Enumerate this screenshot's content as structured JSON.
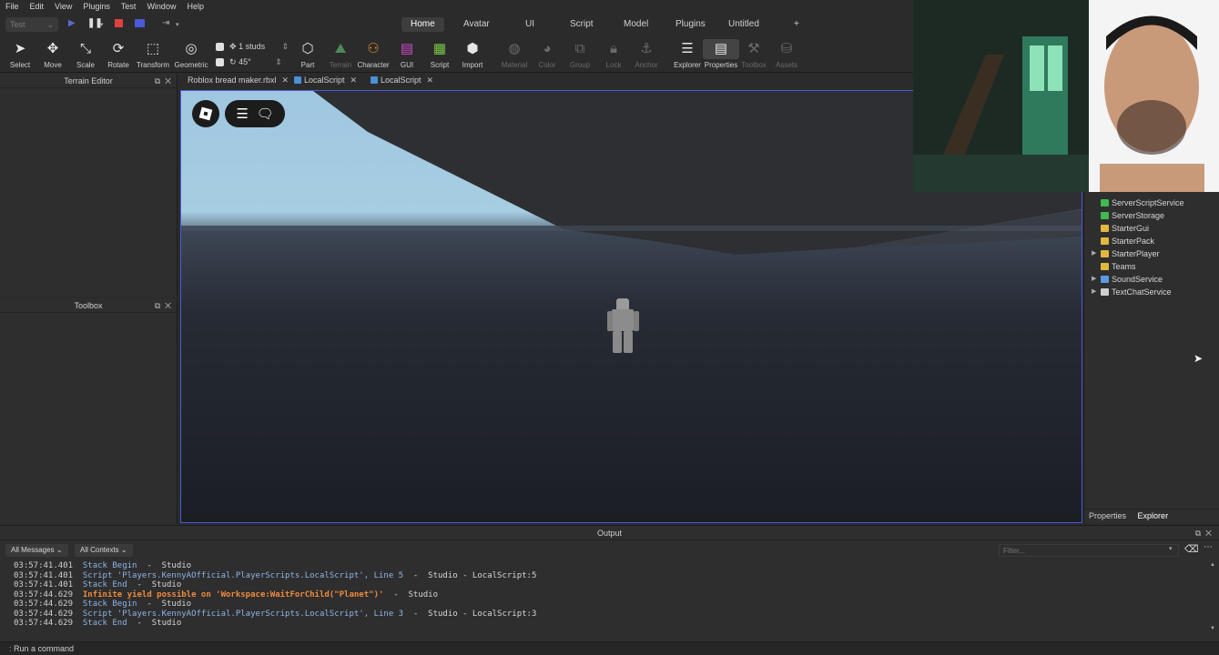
{
  "menu": [
    "File",
    "Edit",
    "View",
    "Plugins",
    "Test",
    "Window",
    "Help"
  ],
  "test_select": "Test",
  "ribbon_tabs": [
    "Home",
    "Avatar",
    "UI",
    "Script",
    "Model",
    "Plugins",
    "Untitled",
    "+"
  ],
  "ribbon_active": "Home",
  "tools": {
    "select": "Select",
    "move": "Move",
    "scale": "Scale",
    "rotate": "Rotate",
    "transform": "Transform",
    "geometric": "Geometric",
    "part": "Part",
    "terrain": "Terrain",
    "character": "Character",
    "gui": "GUI",
    "script": "Script",
    "import": "Import",
    "material": "Material",
    "color": "Color",
    "group": "Group",
    "lock": "Lock",
    "anchor": "Anchor",
    "explorer": "Explorer",
    "properties": "Properties",
    "toolbox": "Toolbox",
    "assets": "Assets"
  },
  "snap": {
    "move": "1 studs",
    "rotate": "45°"
  },
  "panels": {
    "terrain_editor": "Terrain Editor",
    "toolbox": "Toolbox",
    "output": "Output"
  },
  "doc_tabs": [
    "Roblox bread maker.rbxl",
    "LocalScript",
    "LocalScript"
  ],
  "explorer": {
    "items": [
      {
        "label": "ServerScriptService",
        "icon_color": "#3fb950",
        "expandable": false
      },
      {
        "label": "ServerStorage",
        "icon_color": "#3fb950",
        "expandable": false
      },
      {
        "label": "StarterGui",
        "icon_color": "#e0b840",
        "expandable": false
      },
      {
        "label": "StarterPack",
        "icon_color": "#e0b840",
        "expandable": false
      },
      {
        "label": "StarterPlayer",
        "icon_color": "#e0b840",
        "expandable": true
      },
      {
        "label": "Teams",
        "icon_color": "#e0b840",
        "expandable": false
      },
      {
        "label": "SoundService",
        "icon_color": "#5a9be0",
        "expandable": true
      },
      {
        "label": "TextChatService",
        "icon_color": "#cfcfcf",
        "expandable": true
      }
    ],
    "tabs": [
      "Properties",
      "Explorer"
    ]
  },
  "output": {
    "messages_filter": "All Messages",
    "contexts_filter": "All Contexts",
    "filter_placeholder": "Filter...",
    "lines": [
      {
        "ts": "03:57:41.401",
        "msg": "Stack Begin",
        "src": "  -  Studio",
        "warn": false
      },
      {
        "ts": "03:57:41.401",
        "msg": "Script 'Players.KennyAOfficial.PlayerScripts.LocalScript', Line 5",
        "src": "  -  Studio - LocalScript:5",
        "warn": false
      },
      {
        "ts": "03:57:41.401",
        "msg": "Stack End",
        "src": "  -  Studio",
        "warn": false
      },
      {
        "ts": "03:57:44.629",
        "msg": "Infinite yield possible on 'Workspace:WaitForChild(\"Planet\")'",
        "src": "  -  Studio",
        "warn": true
      },
      {
        "ts": "03:57:44.629",
        "msg": "Stack Begin",
        "src": "  -  Studio",
        "warn": false
      },
      {
        "ts": "03:57:44.629",
        "msg": "Script 'Players.KennyAOfficial.PlayerScripts.LocalScript', Line 3",
        "src": "  -  Studio - LocalScript:3",
        "warn": false
      },
      {
        "ts": "03:57:44.629",
        "msg": "Stack End",
        "src": "  -  Studio",
        "warn": false
      }
    ],
    "command_placeholder": "Run a command"
  }
}
